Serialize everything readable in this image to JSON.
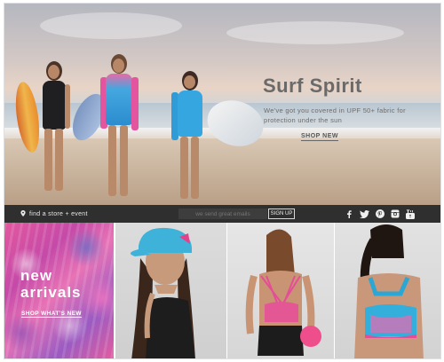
{
  "hero": {
    "title": "Surf Spirit",
    "subtitle": "We've got you covered in UPF 50+ fabric for protection under the sun",
    "cta": "SHOP NEW"
  },
  "bar": {
    "store_link": "find a store + event",
    "email_placeholder": "we send great emails",
    "signup_label": "SIGN UP",
    "social": [
      "facebook-icon",
      "twitter-icon",
      "pinterest-icon",
      "instagram-icon",
      "youtube-icon"
    ]
  },
  "promo": {
    "line1": "new",
    "line2": "arrivals",
    "link": "SHOP WHAT'S NEW"
  },
  "colors": {
    "bar_bg": "#2f2f2f",
    "promo_pink": "#e2589f",
    "title_gray": "#6a6a6a"
  }
}
